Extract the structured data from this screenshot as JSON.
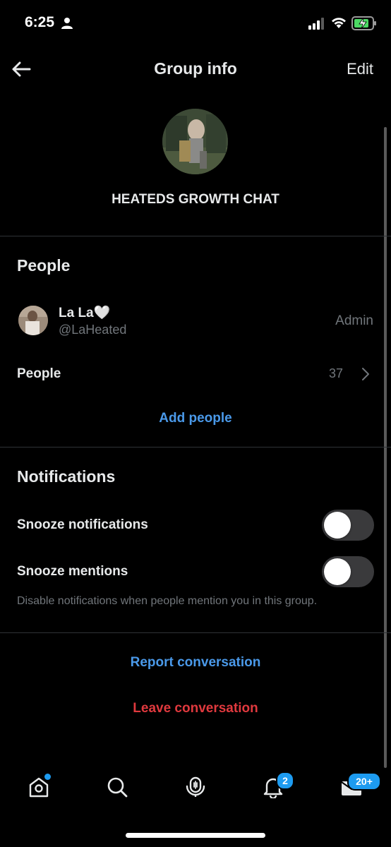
{
  "status_bar": {
    "time": "6:25"
  },
  "nav": {
    "title": "Group info",
    "edit_label": "Edit"
  },
  "group": {
    "name": "HEATEDS GROWTH CHAT"
  },
  "people_section": {
    "title": "People",
    "member": {
      "name": "La La🤍",
      "handle": "@LaHeated",
      "role": "Admin"
    },
    "people_row_label": "People",
    "people_count": "37",
    "add_people_label": "Add people"
  },
  "notifications_section": {
    "title": "Notifications",
    "snooze_notifications_label": "Snooze notifications",
    "snooze_notifications_on": false,
    "snooze_mentions_label": "Snooze mentions",
    "snooze_mentions_on": false,
    "helper_text": "Disable notifications when people mention you in this group."
  },
  "actions": {
    "report_label": "Report conversation",
    "leave_label": "Leave conversation"
  },
  "tabbar": {
    "notifications_badge": "2",
    "messages_badge": "20+"
  },
  "colors": {
    "accent": "#1d9bf0",
    "link": "#4a99e9",
    "danger": "#e0393e",
    "background": "#000000"
  }
}
